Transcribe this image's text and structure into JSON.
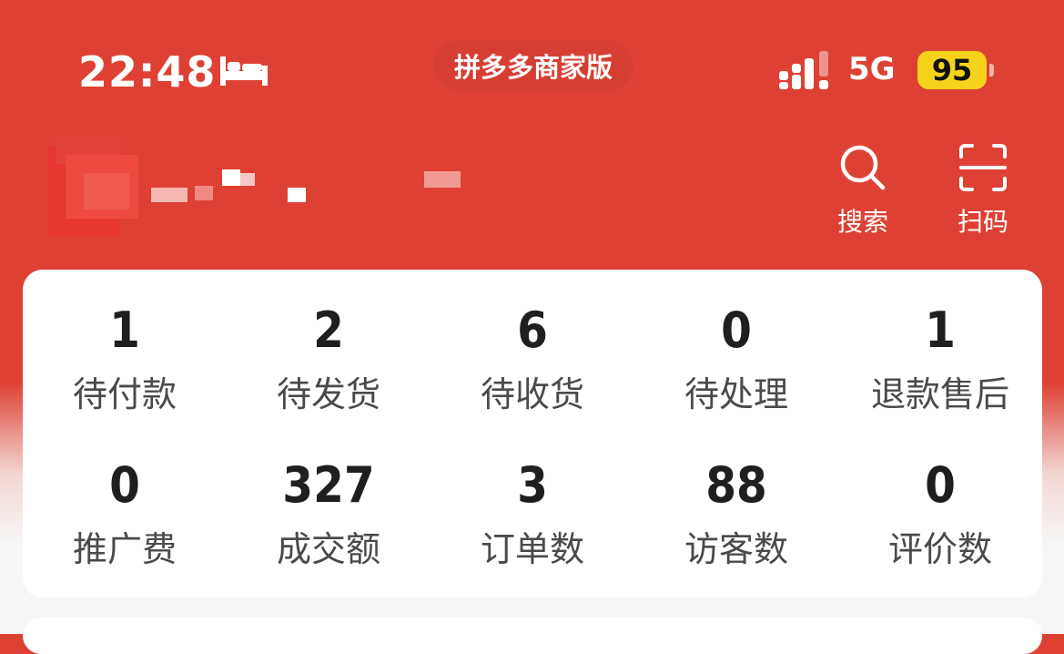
{
  "status_bar": {
    "time": "22:48",
    "app_name": "拼多多商家版",
    "network": "5G",
    "battery": "95",
    "icons": [
      "bed-icon",
      "signal-icon"
    ]
  },
  "header": {
    "actions": [
      {
        "label": "搜索",
        "icon": "search-icon"
      },
      {
        "label": "扫码",
        "icon": "scan-icon"
      }
    ],
    "colors": {
      "brand": "#de4134",
      "battery": "#f7d21a"
    }
  },
  "stats": {
    "row1": [
      {
        "value": "1",
        "label": "待付款"
      },
      {
        "value": "2",
        "label": "待发货"
      },
      {
        "value": "6",
        "label": "待收货"
      },
      {
        "value": "0",
        "label": "待处理"
      },
      {
        "value": "1",
        "label": "退款售后"
      }
    ],
    "row2": [
      {
        "value": "0",
        "label": "推广费"
      },
      {
        "value": "327",
        "label": "成交额"
      },
      {
        "value": "3",
        "label": "订单数"
      },
      {
        "value": "88",
        "label": "访客数"
      },
      {
        "value": "0",
        "label": "评价数"
      }
    ]
  }
}
